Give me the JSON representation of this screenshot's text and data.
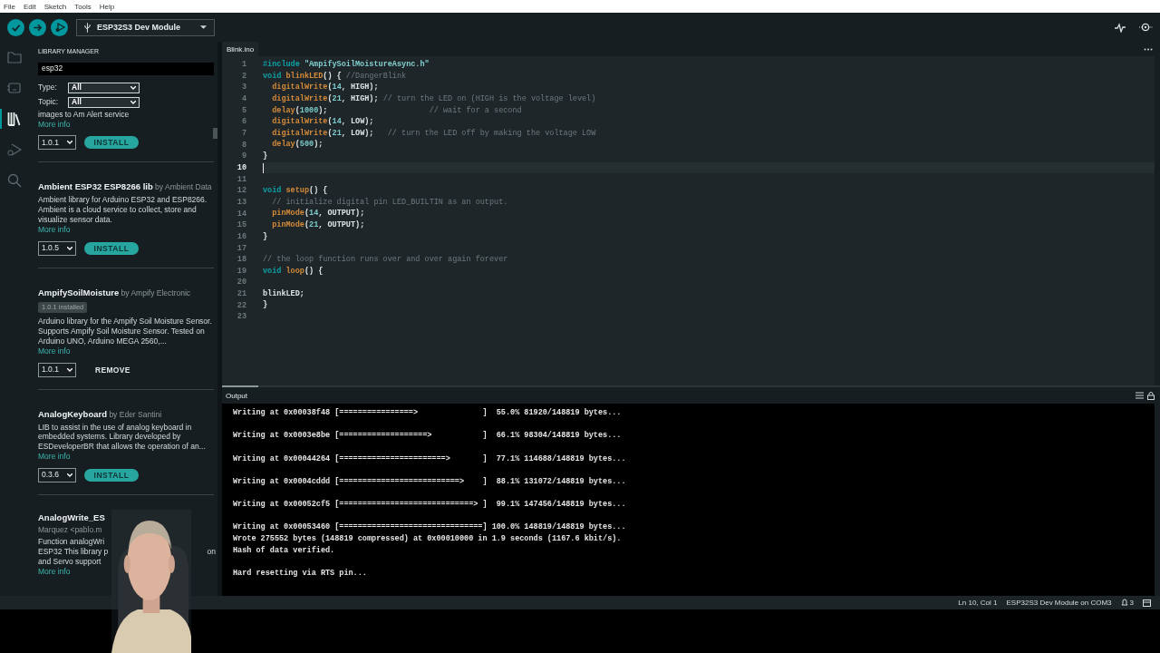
{
  "menu": [
    "File",
    "Edit",
    "Sketch",
    "Tools",
    "Help"
  ],
  "toolbar": {
    "board": "ESP32S3 Dev Module"
  },
  "activity_bar": [
    {
      "kind": "folder",
      "selected": false
    },
    {
      "kind": "board",
      "selected": false
    },
    {
      "kind": "library",
      "selected": true
    },
    {
      "kind": "debug",
      "selected": false
    },
    {
      "kind": "search",
      "selected": false
    }
  ],
  "library_manager": {
    "title": "LIBRARY MANAGER",
    "search": {
      "value": "esp32"
    },
    "filters": [
      {
        "label": "Type:",
        "value": "All"
      },
      {
        "label": "Topic:",
        "value": "All"
      }
    ],
    "items": [
      {
        "kind": "cut_top",
        "description": "images to Am Alert service",
        "more_info": "More info",
        "version": "1.0.1",
        "action": {
          "kind": "install",
          "label": "INSTALL"
        }
      },
      {
        "kind": "full",
        "name": "Ambient ESP32 ESP8266 lib",
        "author": "by Ambient Data",
        "description": "Ambient library for Arduino ESP32 and ESP8266. Ambient is a cloud service to collect, store and visualize sensor data.",
        "more_info": "More info",
        "version": "1.0.5",
        "action": {
          "kind": "install",
          "label": "INSTALL"
        }
      },
      {
        "kind": "full",
        "name": "AmpifySoilMoisture",
        "author": "by Ampify Electronic",
        "badge": "1.0.1 installed",
        "description": "Arduino library for the Ampify Soil Moisture Sensor. Supports Ampify Soil Moisture Sensor. Tested on Arduino UNO, Arduino MEGA 2560,...",
        "more_info": "More info",
        "version": "1.0.1",
        "action": {
          "kind": "remove",
          "label": "REMOVE"
        }
      },
      {
        "kind": "full",
        "name": "AnalogKeyboard",
        "author": "by Eder Santini",
        "description": "LIB to assist in the use of analog keyboard in embedded systems. Library developed by ESDeveloperBR that allows the operation of an...",
        "more_info": "More info",
        "version": "0.3.6",
        "action": {
          "kind": "install",
          "label": "INSTALL"
        }
      },
      {
        "kind": "covered",
        "name": "AnalogWrite_ES",
        "author": "Marquez <pablo.m",
        "description_lines": [
          {
            "text": "Function analogWri"
          },
          {
            "text": "ESP32 This library p",
            "tail": "on"
          },
          {
            "text": "and Servo support"
          }
        ],
        "more_info": "More info"
      }
    ]
  },
  "editor": {
    "tab": "Blink.ino",
    "lines": [
      {
        "number": "1",
        "current": false,
        "tokens": [
          {
            "kind": "directive",
            "text": "#include"
          },
          {
            "kind": "string",
            "text": " \"AmpifySoilMoistureAsync.h\""
          }
        ]
      },
      {
        "number": "2",
        "current": false,
        "tokens": [
          {
            "kind": "keyword",
            "text": "void "
          },
          {
            "kind": "function",
            "text": "blinkLED"
          },
          {
            "kind": "plain",
            "text": "() { "
          },
          {
            "kind": "comment",
            "text": "//DangerBlink"
          }
        ]
      },
      {
        "number": "3",
        "current": false,
        "tokens": [
          {
            "kind": "function",
            "text": "  digitalWrite"
          },
          {
            "kind": "plain",
            "text": "("
          },
          {
            "kind": "number",
            "text": "14"
          },
          {
            "kind": "plain",
            "text": ", HIGH);"
          }
        ]
      },
      {
        "number": "4",
        "current": false,
        "tokens": [
          {
            "kind": "function",
            "text": "  digitalWrite"
          },
          {
            "kind": "plain",
            "text": "("
          },
          {
            "kind": "number",
            "text": "21"
          },
          {
            "kind": "plain",
            "text": ", HIGH); "
          },
          {
            "kind": "comment",
            "text": "// turn the LED on (HIGH is the voltage level)"
          }
        ]
      },
      {
        "number": "5",
        "current": false,
        "tokens": [
          {
            "kind": "function",
            "text": "  delay"
          },
          {
            "kind": "plain",
            "text": "("
          },
          {
            "kind": "number",
            "text": "1000"
          },
          {
            "kind": "plain",
            "text": ");                      "
          },
          {
            "kind": "comment",
            "text": "// wait for a second"
          }
        ]
      },
      {
        "number": "6",
        "current": false,
        "tokens": [
          {
            "kind": "function",
            "text": "  digitalWrite"
          },
          {
            "kind": "plain",
            "text": "("
          },
          {
            "kind": "number",
            "text": "14"
          },
          {
            "kind": "plain",
            "text": ", LOW);"
          }
        ]
      },
      {
        "number": "7",
        "current": false,
        "tokens": [
          {
            "kind": "function",
            "text": "  digitalWrite"
          },
          {
            "kind": "plain",
            "text": "("
          },
          {
            "kind": "number",
            "text": "21"
          },
          {
            "kind": "plain",
            "text": ", LOW);   "
          },
          {
            "kind": "comment",
            "text": "// turn the LED off by making the voltage LOW"
          }
        ]
      },
      {
        "number": "8",
        "current": false,
        "tokens": [
          {
            "kind": "function",
            "text": "  delay"
          },
          {
            "kind": "plain",
            "text": "("
          },
          {
            "kind": "number",
            "text": "500"
          },
          {
            "kind": "plain",
            "text": ");"
          }
        ]
      },
      {
        "number": "9",
        "current": false,
        "tokens": [
          {
            "kind": "plain",
            "text": "}"
          }
        ]
      },
      {
        "number": "10",
        "current": true
      },
      {
        "number": "11",
        "current": false
      },
      {
        "number": "12",
        "current": false,
        "tokens": [
          {
            "kind": "keyword",
            "text": "void "
          },
          {
            "kind": "function",
            "text": "setup"
          },
          {
            "kind": "plain",
            "text": "() {"
          }
        ]
      },
      {
        "number": "13",
        "current": false,
        "tokens": [
          {
            "kind": "comment",
            "text": "  // initialize digital pin LED_BUILTIN as an output."
          }
        ]
      },
      {
        "number": "14",
        "current": false,
        "tokens": [
          {
            "kind": "function",
            "text": "  pinMode"
          },
          {
            "kind": "plain",
            "text": "("
          },
          {
            "kind": "number",
            "text": "14"
          },
          {
            "kind": "plain",
            "text": ", OUTPUT);"
          }
        ]
      },
      {
        "number": "15",
        "current": false,
        "tokens": [
          {
            "kind": "function",
            "text": "  pinMode"
          },
          {
            "kind": "plain",
            "text": "("
          },
          {
            "kind": "number",
            "text": "21"
          },
          {
            "kind": "plain",
            "text": ", OUTPUT);"
          }
        ]
      },
      {
        "number": "16",
        "current": false,
        "tokens": [
          {
            "kind": "plain",
            "text": "}"
          }
        ]
      },
      {
        "number": "17",
        "current": false
      },
      {
        "number": "18",
        "current": false,
        "tokens": [
          {
            "kind": "comment",
            "text": "// the loop function runs over and over again forever"
          }
        ]
      },
      {
        "number": "19",
        "current": false,
        "tokens": [
          {
            "kind": "keyword",
            "text": "void "
          },
          {
            "kind": "function",
            "text": "loop"
          },
          {
            "kind": "plain",
            "text": "() {"
          }
        ]
      },
      {
        "number": "20",
        "current": false
      },
      {
        "number": "21",
        "current": false,
        "tokens": [
          {
            "kind": "plain",
            "text": "blinkLED;"
          }
        ]
      },
      {
        "number": "22",
        "current": false,
        "tokens": [
          {
            "kind": "plain",
            "text": "}"
          }
        ]
      },
      {
        "number": "23",
        "current": false
      }
    ]
  },
  "output": {
    "title": "Output",
    "blocks": [
      [
        "Writing at 0x00038f48 [================>              ]  55.0% 81920/148819 bytes..."
      ],
      [
        "Writing at 0x0003e8be [===================>           ]  66.1% 98304/148819 bytes..."
      ],
      [
        "Writing at 0x00044264 [=======================>       ]  77.1% 114688/148819 bytes..."
      ],
      [
        "Writing at 0x0004cddd [==========================>    ]  88.1% 131072/148819 bytes..."
      ],
      [
        "Writing at 0x00052cf5 [=============================> ]  99.1% 147456/148819 bytes..."
      ],
      [
        "Writing at 0x00053460 [===============================] 100.0% 148819/148819 bytes...",
        "Wrote 275552 bytes (148819 compressed) at 0x00010000 in 1.9 seconds (1167.6 kbit/s).",
        "Hash of data verified."
      ],
      [
        "Hard resetting via RTS pin..."
      ]
    ]
  },
  "status_bar": {
    "position": "Ln 10, Col 1",
    "board": "ESP32S3 Dev Module on COM3",
    "notifications": "3"
  }
}
